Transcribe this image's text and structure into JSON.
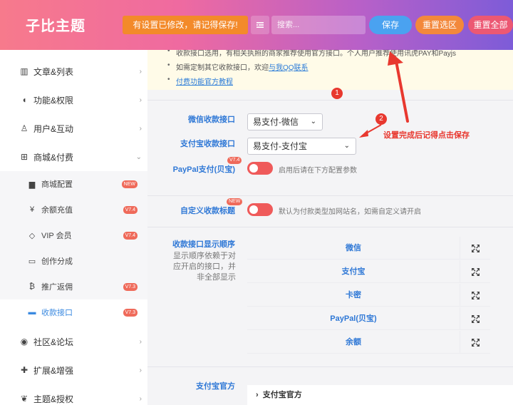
{
  "header": {
    "logo": "子比主题",
    "notice": "有设置已修改，请记得保存!",
    "search_placeholder": "搜索...",
    "save_label": "保存",
    "reset_selected_label": "重置选区",
    "reset_all_label": "重置全部"
  },
  "sidebar": {
    "items": [
      {
        "label": "文章&列表",
        "icon": "columns-icon"
      },
      {
        "label": "功能&权限",
        "icon": "shield-icon"
      },
      {
        "label": "用户&互动",
        "icon": "user-icon"
      },
      {
        "label": "商城&付费",
        "icon": "cart-icon"
      },
      {
        "label": "社区&论坛",
        "icon": "compass-icon"
      },
      {
        "label": "扩展&增强",
        "icon": "puzzle-icon"
      },
      {
        "label": "主题&授权",
        "icon": "theme-icon"
      }
    ],
    "sub_items": [
      {
        "label": "商城配置",
        "badge": "NEW",
        "icon": "bag-icon"
      },
      {
        "label": "余额充值",
        "badge": "V7.4",
        "icon": "yen-icon"
      },
      {
        "label": "VIP 会员",
        "badge": "V7.4",
        "icon": "diamond-icon"
      },
      {
        "label": "创作分成",
        "badge": "",
        "icon": "inbox-icon"
      },
      {
        "label": "推广返佣",
        "badge": "V7.3",
        "icon": "bitcoin-icon"
      },
      {
        "label": "收款接口",
        "badge": "V7.3",
        "icon": "card-icon"
      }
    ]
  },
  "tips": {
    "line1": "收款接口选用，有相关执照的商家推荐使用官方接口。个人用户推荐使用讯虎PAY和Payjs",
    "line2_prefix": "如需定制其它收款接口，欢迎",
    "line2_link": "与我QQ联系",
    "line3_link": "付费功能官方教程"
  },
  "form": {
    "wechat_label": "微信收款接口",
    "wechat_value": "易支付-微信",
    "alipay_label": "支付宝收款接口",
    "alipay_value": "易支付-支付宝",
    "paypal_label": "PayPal支付(贝宝)",
    "paypal_tag": "V7.4",
    "paypal_hint": "启用后请在下方配置参数",
    "custom_label": "自定义收款标题",
    "custom_tag": "NEW",
    "custom_hint": "默认为付款类型加网站名，如需自定义请开启",
    "order_label": "收款接口显示顺序",
    "order_desc": "显示顺序依赖于对应开启的接口，并非全部显示",
    "order_items": [
      "微信",
      "支付宝",
      "卡密",
      "PayPal(贝宝)",
      "余额"
    ],
    "alipay_official_label": "支付宝官方",
    "alipay_official_collapse": "支付宝官方"
  },
  "annotations": {
    "step1": "1",
    "step2": "2",
    "save_note": "设置完成后记得点击保存"
  },
  "colors": {
    "accent_blue": "#2f78d6",
    "annotation_red": "#e8382f",
    "toggle_red": "#ef5a5a"
  }
}
